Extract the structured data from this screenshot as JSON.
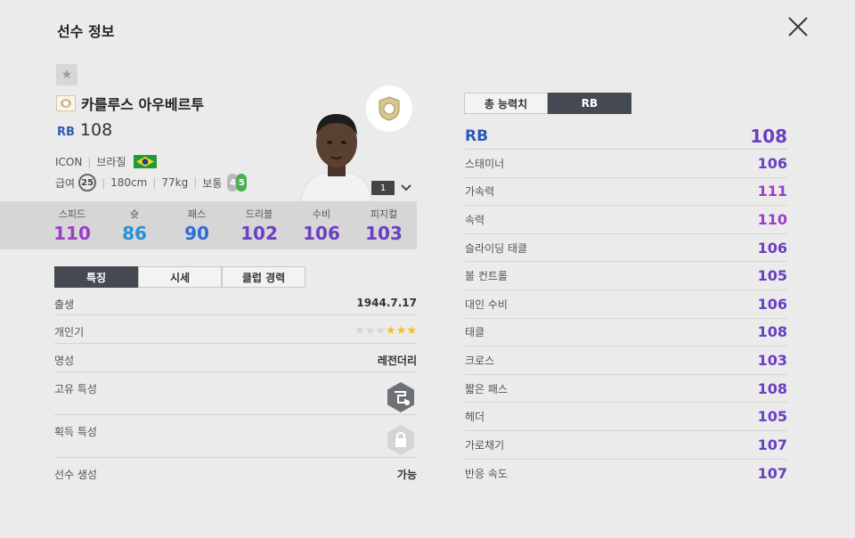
{
  "header": {
    "title": "선수 정보"
  },
  "player": {
    "name": "카를루스 아우베르투",
    "position": "RB",
    "ovr": "108",
    "season": "ICON",
    "nation": "브라질",
    "pay_label": "급여",
    "pay": "25",
    "height": "180cm",
    "weight": "77kg",
    "body": "보통",
    "weak_foot": "4",
    "strong_foot": "5",
    "enhance_level": "1"
  },
  "summary_stats": [
    {
      "label": "스피드",
      "value": "110",
      "color": "#9d3cc9"
    },
    {
      "label": "슛",
      "value": "86",
      "color": "#2b8fd6"
    },
    {
      "label": "패스",
      "value": "90",
      "color": "#2b6fd6"
    },
    {
      "label": "드리블",
      "value": "102",
      "color": "#6a3fc1"
    },
    {
      "label": "수비",
      "value": "106",
      "color": "#6a3fc1"
    },
    {
      "label": "피지컬",
      "value": "103",
      "color": "#6a3fc1"
    }
  ],
  "tabs": [
    "특징",
    "시세",
    "클럽 경력"
  ],
  "info": {
    "birth_label": "출생",
    "birth": "1944.7.17",
    "popularity_label": "개인기",
    "popularity_stars": 3,
    "popularity_max": 6,
    "fame_label": "명성",
    "fame": "레전더리",
    "unique_trait_label": "고유 특성",
    "acquired_trait_label": "획득 특성",
    "create_label": "선수 생성",
    "create": "가능"
  },
  "right_tabs": [
    "총 능력치",
    "RB"
  ],
  "attributes_head": {
    "position": "RB",
    "value": "108"
  },
  "attributes": [
    {
      "label": "스태미너",
      "value": "106"
    },
    {
      "label": "가속력",
      "value": "111",
      "pink": true
    },
    {
      "label": "속력",
      "value": "110",
      "pink": true
    },
    {
      "label": "슬라이딩 태클",
      "value": "106"
    },
    {
      "label": "볼 컨트롤",
      "value": "105"
    },
    {
      "label": "대인 수비",
      "value": "106"
    },
    {
      "label": "태클",
      "value": "108"
    },
    {
      "label": "크로스",
      "value": "103"
    },
    {
      "label": "짧은 패스",
      "value": "108"
    },
    {
      "label": "헤더",
      "value": "105"
    },
    {
      "label": "가로채기",
      "value": "107"
    },
    {
      "label": "반응 속도",
      "value": "107"
    }
  ]
}
